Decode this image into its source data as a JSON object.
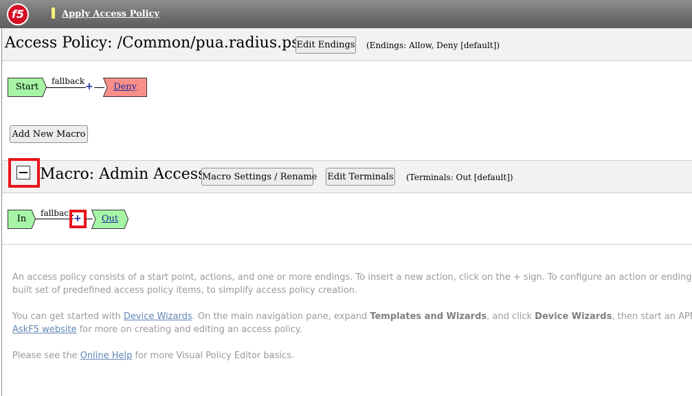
{
  "header": {
    "logo_text": "f5",
    "apply_link": "Apply Access Policy"
  },
  "policy": {
    "title": "Access Policy: /Common/pua.radius.psp",
    "edit_endings_label": "Edit Endings",
    "endings_note": "(Endings: Allow, Deny [default])",
    "start_label": "Start",
    "branch_label": "fallback",
    "plus": "+",
    "ending_label": "Deny",
    "add_macro_label": "Add New Macro"
  },
  "macro": {
    "title": "Macro: Admin Access",
    "settings_label": "Macro Settings / Rename",
    "edit_terminals_label": "Edit Terminals",
    "terminals_note": "(Terminals: Out [default])",
    "in_label": "In",
    "branch_label": "fallback",
    "plus": "+",
    "out_label": "Out"
  },
  "help": {
    "p1_line1": "An access policy consists of a start point, actions, and one or more endings. To insert a new action, click on the + sign. To configure an action or ending, click o",
    "p1_line2": "built set of predefined access policy items, to simplify access policy creation.",
    "p2_prefix": "You can get started with ",
    "p2_link1": "Device Wizards",
    "p2_mid1": ". On the main navigation pane, expand ",
    "p2_bold1": "Templates and Wizards",
    "p2_mid2": ", and click ",
    "p2_bold2": "Device Wizards",
    "p2_suffix": ", then start an APM Config",
    "p2_link2": "AskF5 website",
    "p2_line2_suffix": " for more on creating and editing an access policy.",
    "p3_prefix": "Please see the ",
    "p3_link": "Online Help",
    "p3_suffix": " for more Visual Policy Editor basics."
  },
  "colors": {
    "start_node": "#a6f5a6",
    "deny_node": "#fa8f8a",
    "terminal_node": "#a6f5a6",
    "highlight": "#e8141a",
    "link": "#5f85b5"
  }
}
